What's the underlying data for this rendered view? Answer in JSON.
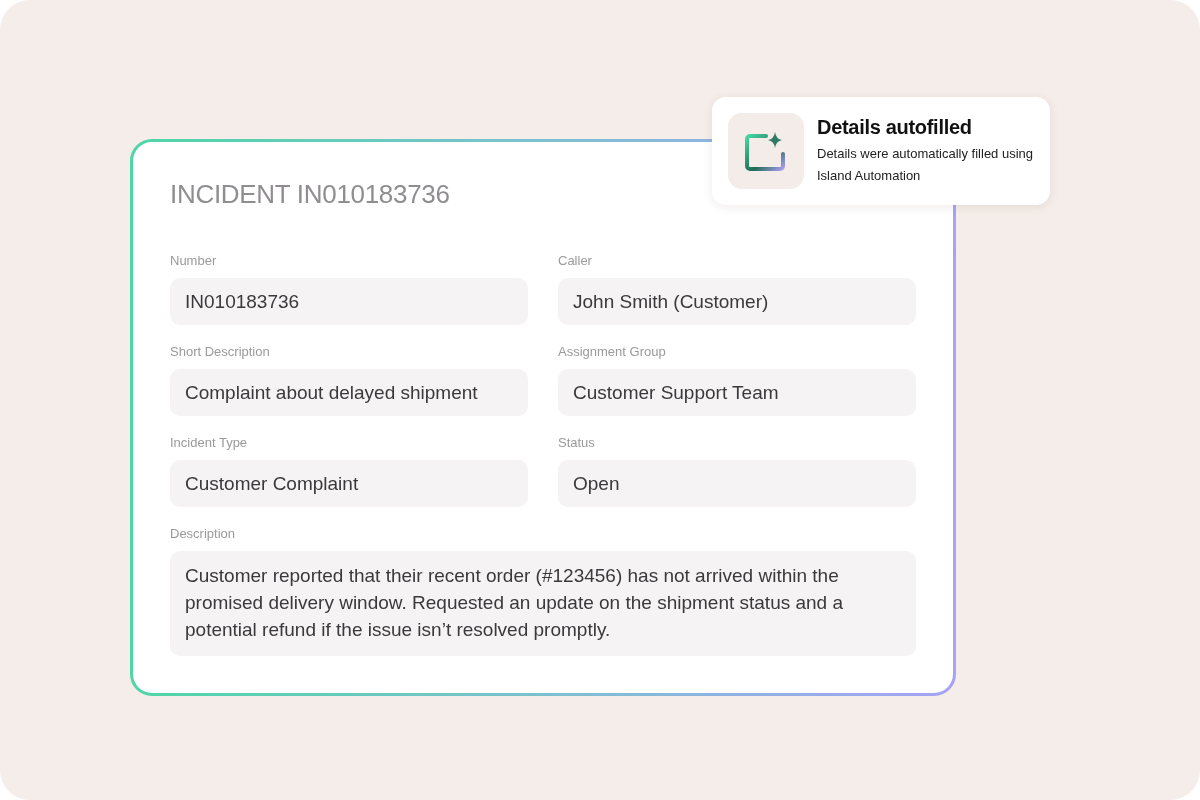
{
  "toast": {
    "title": "Details autofilled",
    "message": "Details were automatically filled using Island Automation"
  },
  "incident": {
    "title": "INCIDENT IN010183736",
    "fields": [
      {
        "label": "Number",
        "value": "IN010183736"
      },
      {
        "label": "Caller",
        "value": "John Smith (Customer)"
      },
      {
        "label": "Short Description",
        "value": "Complaint about delayed shipment"
      },
      {
        "label": "Assignment Group",
        "value": "Customer Support Team"
      },
      {
        "label": "Incident Type",
        "value": "Customer Complaint"
      },
      {
        "label": "Status",
        "value": "Open"
      }
    ],
    "description": {
      "label": "Description",
      "value": "Customer reported that their recent order (#123456) has not arrived within the promised delivery window. Requested an update on the shipment status and a potential refund if the issue isn’t resolved promptly."
    }
  }
}
